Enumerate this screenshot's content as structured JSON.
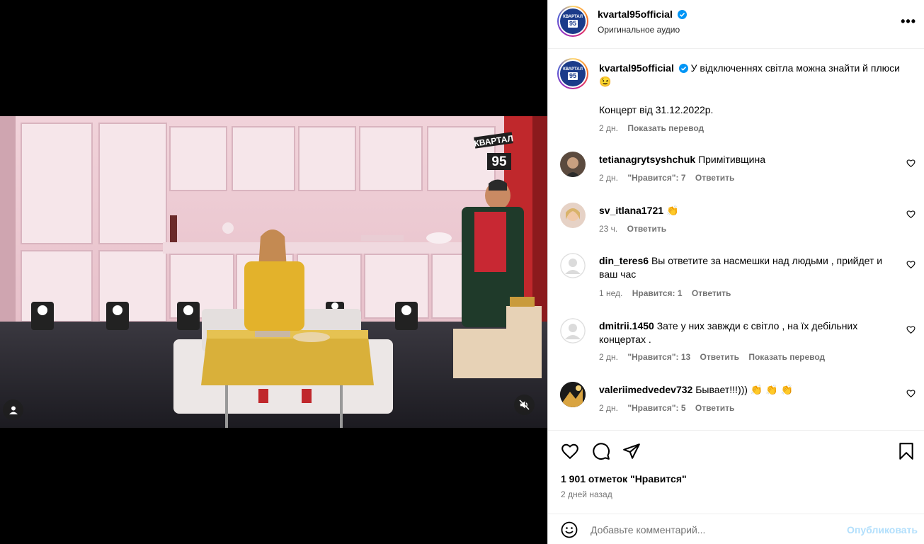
{
  "post": {
    "username": "kvartal95official",
    "audio": "Оригинальное аудио",
    "more": "•••",
    "logo_text_top": "КВАРТАЛ",
    "logo_text_num": "95",
    "caption": "У відключеннях світла можна знайти й плюси 😉",
    "concert": "Концерт від 31.12.2022р.",
    "caption_time": "2 дн.",
    "caption_translate": "Показать перевод"
  },
  "video": {
    "watermark_top": "КВАРТАЛ",
    "watermark_num": "95"
  },
  "comments": [
    {
      "user": "tetianagrytsyshchuk",
      "text": "Примітивщина",
      "time": "2 дн.",
      "likes": "\"Нравится\": 7",
      "reply": "Ответить",
      "translate": ""
    },
    {
      "user": "sv_itlana1721",
      "text": "👏",
      "time": "23 ч.",
      "likes": "",
      "reply": "Ответить",
      "translate": ""
    },
    {
      "user": "din_teres6",
      "text": "Вы ответите за насмешки над людьми , прийдет и ваш час",
      "time": "1 нед.",
      "likes": "Нравится: 1",
      "reply": "Ответить",
      "translate": ""
    },
    {
      "user": "dmitrii.1450",
      "text": "Зате у них завжди є світло , на їх дебільних концертах .",
      "time": "2 дн.",
      "likes": "\"Нравится\": 13",
      "reply": "Ответить",
      "translate": "Показать перевод"
    },
    {
      "user": "valeriimedvedev732",
      "text": "Бывает!!!))) 👏 👏 👏",
      "time": "2 дн.",
      "likes": "\"Нравится\": 5",
      "reply": "Ответить",
      "translate": ""
    }
  ],
  "footer": {
    "likes": "1 901 отметок \"Нравится\"",
    "date": "2 дней назад",
    "comment_placeholder": "Добавьте комментарий...",
    "publish": "Опубликовать"
  },
  "colors": {
    "verified": "#0095f6",
    "publish_disabled": "#b2dffc",
    "muted": "#737373"
  }
}
